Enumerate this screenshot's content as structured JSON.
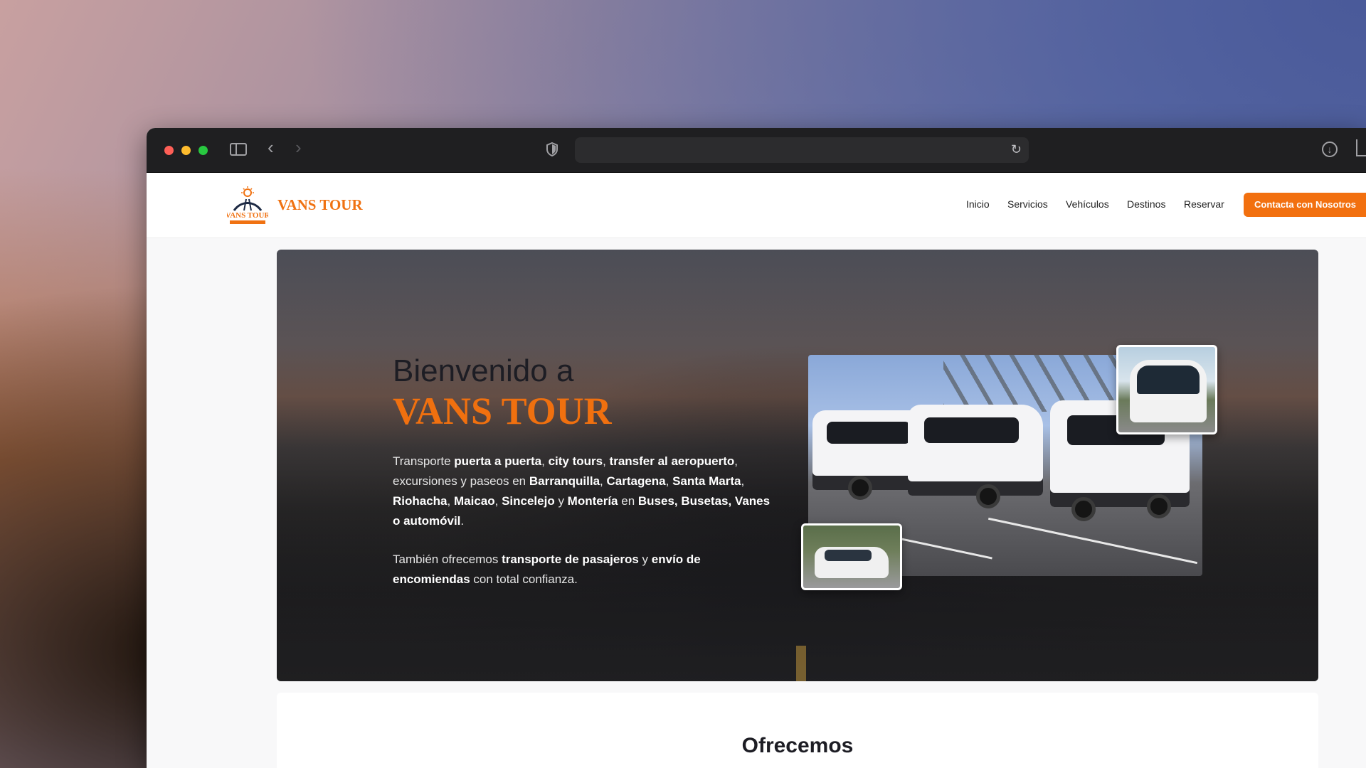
{
  "site": {
    "brand": "VANS TOUR",
    "logo_text": "VANS TOUR"
  },
  "nav": {
    "items": [
      {
        "label": "Inicio"
      },
      {
        "label": "Servicios"
      },
      {
        "label": "Vehículos"
      },
      {
        "label": "Destinos"
      },
      {
        "label": "Reservar"
      }
    ],
    "cta_label": "Contacta con Nosotros"
  },
  "hero": {
    "title_line1": "Bienvenido a",
    "title_brand": "VANS TOUR",
    "p1": {
      "t1": "Transporte ",
      "b1": "puerta a puerta",
      "t2": ", ",
      "b2": "city tours",
      "t3": ", ",
      "b3": "transfer al aeropuerto",
      "t4": ", excursiones y paseos en ",
      "b4": "Barranquilla",
      "t5": ", ",
      "b5": "Cartagena",
      "t6": ", ",
      "b6": "Santa Marta",
      "t7": ", ",
      "b7": "Riohacha",
      "t8": ", ",
      "b8": "Maicao",
      "t9": ", ",
      "b9": "Sincelejo",
      "t10": " y ",
      "b10": "Montería",
      "t11": " en ",
      "b11": "Buses, Busetas, Vanes o automóvil",
      "t12": "."
    },
    "p2": {
      "t1": "También ofrecemos ",
      "b1": "transporte de pasajeros",
      "t2": " y ",
      "b2": "envío de encomiendas",
      "t3": " con total confianza."
    }
  },
  "section": {
    "title": "Ofrecemos"
  },
  "icons": {
    "sidebar": "sidebar-icon",
    "back": "chevron-left-icon",
    "forward": "chevron-right-icon",
    "shield": "shield-icon",
    "reload": "reload-icon",
    "download": "download-icon",
    "share": "share-icon"
  },
  "colors": {
    "accent": "#f2700f",
    "brand_text": "#f07212",
    "title_dark": "#1d1d24"
  }
}
